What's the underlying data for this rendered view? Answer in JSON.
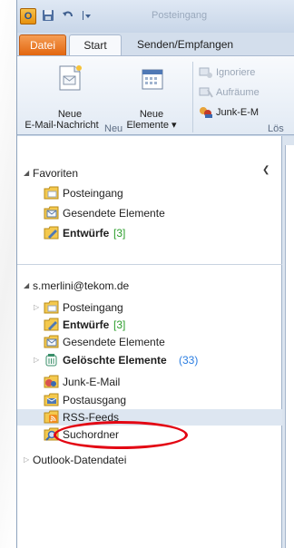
{
  "titlebar": {
    "app_icon_glyph": "O",
    "quick_access": [
      "save-icon",
      "undo-icon",
      "customize-icon"
    ],
    "title": "Posteingang"
  },
  "tabs": [
    {
      "label": "Datei"
    },
    {
      "label": "Start"
    },
    {
      "label": "Senden/Empfangen"
    }
  ],
  "ribbon": {
    "new_email_label_1": "Neue",
    "new_email_label_2": "E-Mail-Nachricht",
    "new_items_label_1": "Neue",
    "new_items_label_2": "Elemente ▾",
    "group_new": "Neu",
    "ignore_label": "Ignoriere",
    "cleanup_label": "Aufräume",
    "junk_label": "Junk-E-M",
    "group_delete": "Lös"
  },
  "nav": {
    "favorites": {
      "header": "Favoriten",
      "items": [
        {
          "label": "Posteingang",
          "count": ""
        },
        {
          "label": "Gesendete Elemente",
          "count": ""
        },
        {
          "label": "Entwürfe",
          "count": "[3]"
        }
      ]
    },
    "account": {
      "header": "s.merlini@tekom.de",
      "items": [
        {
          "label": "Posteingang",
          "count": ""
        },
        {
          "label": "Entwürfe",
          "count": "[3]"
        },
        {
          "label": "Gesendete Elemente",
          "count": ""
        },
        {
          "label": "Gelöschte Elemente",
          "count": "(33)"
        },
        {
          "label": "Junk-E-Mail",
          "count": ""
        },
        {
          "label": "Postausgang",
          "count": ""
        },
        {
          "label": "RSS-Feeds",
          "count": ""
        },
        {
          "label": "Suchordner",
          "count": ""
        }
      ]
    },
    "datafile": {
      "header": "Outlook-Datendatei"
    }
  },
  "colors": {
    "accent_file_tab": "#e2660f",
    "count_blue": "#2a7de1",
    "highlight_red": "#e30613"
  }
}
